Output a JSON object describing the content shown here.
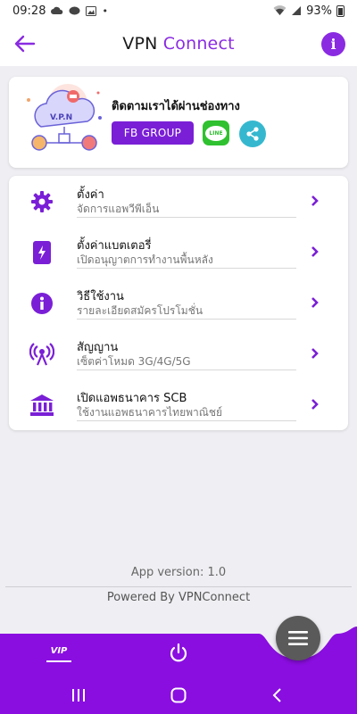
{
  "status_bar": {
    "time": "09:28",
    "battery": "93%",
    "icons": [
      "cloud-icon",
      "line-icon",
      "image-icon",
      "dot-icon",
      "wifi-icon",
      "signal-icon",
      "battery-icon"
    ]
  },
  "header": {
    "title_part1": "VPN",
    "title_part2": "Connect",
    "back_icon": "back-arrow-icon",
    "info_icon": "info-icon",
    "info_glyph": "i"
  },
  "promo": {
    "heading": "ติดตามเราได้ผ่านช่องทาง",
    "fb_button": "FB GROUP",
    "line_label": "LINE",
    "art_label": "V.P.N"
  },
  "menu": {
    "items": [
      {
        "title": "ตั้งค่า",
        "subtitle": "จัดการแอพวีพีเอ็น",
        "icon": "gear-icon"
      },
      {
        "title": "ตั้งค่าแบตเตอรี่",
        "subtitle": "เปิดอนุญาตการทำงานพื้นหลัง",
        "icon": "battery-charging-icon"
      },
      {
        "title": "วิธีใช้งาน",
        "subtitle": "รายละเอียดสมัครโปรโมชั่น",
        "icon": "info-circle-icon"
      },
      {
        "title": "สัญญาน",
        "subtitle": "เซ็ตค่าโหมด 3G/4G/5G",
        "icon": "antenna-icon"
      },
      {
        "title": "เปิดแอพธนาคาร SCB",
        "subtitle": "ใช้งานแอพธนาคารไทยพาณิชย์",
        "icon": "bank-icon"
      }
    ]
  },
  "footer": {
    "version": "App version: 1.0",
    "powered": "Powered By VPNConnect"
  },
  "bottom_nav": {
    "vip_label": "VIP",
    "power_icon": "power-icon",
    "menu_icon": "hamburger-menu-icon"
  },
  "colors": {
    "accent": "#8a2be2",
    "nav_bar": "#8a0ee0",
    "fab": "#5a5a5a"
  }
}
